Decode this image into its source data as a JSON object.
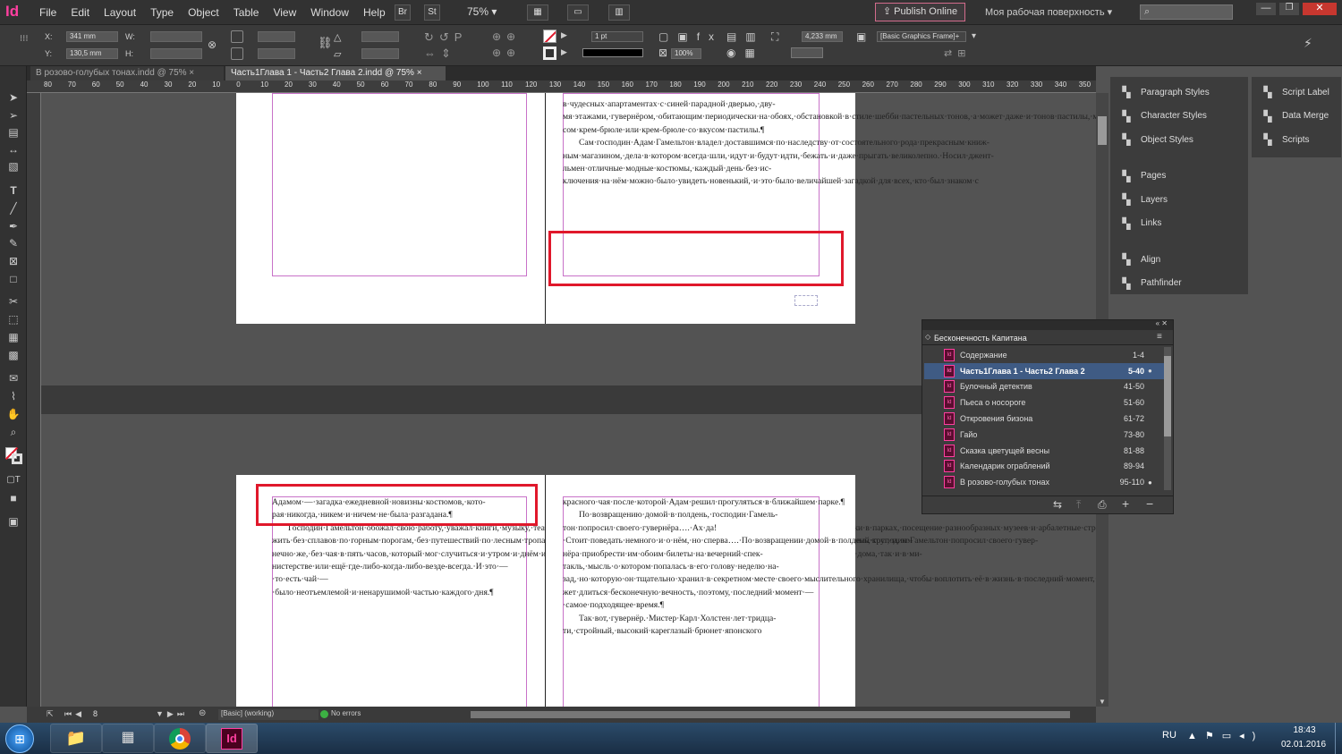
{
  "app": {
    "logo": "Id",
    "menu": [
      "File",
      "Edit",
      "Layout",
      "Type",
      "Object",
      "Table",
      "View",
      "Window",
      "Help"
    ],
    "br_badge": "Br",
    "st_badge": "St",
    "zoom": "75%",
    "publish_online": "Publish Online",
    "workspace": "Моя рабочая поверхность"
  },
  "control": {
    "x_label": "X:",
    "x_value": "341 mm",
    "y_label": "Y:",
    "y_value": "130,5 mm",
    "w_label": "W:",
    "h_label": "H:",
    "stroke_weight": "1 pt",
    "zoom_field": "100%",
    "size_field": "4,233 mm",
    "frame_style": "[Basic Graphics Frame]+"
  },
  "tabs": [
    {
      "label": "В розово-голубых тонах.indd @ 75%",
      "close": "×"
    },
    {
      "label": "Часть1Глава 1 - Часть2 Глава 2.indd @ 75%",
      "close": "×"
    }
  ],
  "ruler_ticks": [
    "80",
    "70",
    "60",
    "50",
    "40",
    "30",
    "20",
    "10",
    "0",
    "10",
    "20",
    "30",
    "40",
    "50",
    "60",
    "70",
    "80",
    "90",
    "100",
    "110",
    "120",
    "130",
    "140",
    "150",
    "160",
    "170",
    "180",
    "190",
    "200",
    "210",
    "220",
    "230",
    "240",
    "250",
    "260",
    "270",
    "280",
    "290",
    "300",
    "310",
    "320",
    "330",
    "340",
    "350"
  ],
  "doc": {
    "top_right_text": "в·чудесных·апартаментах·с·синей·парадной·дверью,·дву-мя·этажами,·гувернёром,·обитающим·периодически·на·обоях,·обстановкой·в·стиле·шебби·пастельных·тонов,·а·может·даже·и·тонов·пастилы,·может·даже·пастилы·со·вку-сом·крем-брюле·или·крем-брюле·со·вкусом·пастилы.¶",
    "top_right_text2": "Сам·господин·Адам·Гамельтон·владел·доставшимся·по·наследству·от·состоятельного·рода·прекрасным·книж-ным·магазином,·дела·в·котором·всегда·шли,·идут·и·будут·идти,·бежать·и·даже·прыгать·великолепно.·Носил·джент-льмен·отличные·модные·костюмы,·каждый·день·без·ис-ключения·на·нём·можно·было·увидеть·новенький,·и·это·было·величайшей·загадкой·для·всех,·кто·был·знаком·с",
    "bottom_left_text": "Адамом·—·загадка·ежедневной·новизны·костюмов,·кото-рая·никогда,·никем·и·ничем·не·была·разгадана.¶",
    "bottom_left_text2": "Господин·Гамельтон·обожал·свою·работу,·уважал·книги,·музыку,·театр,·а·также·крокет,·верховую·езду,·бадминтон,·фехтование,·поездки·загород,·пикники·в·парках,·посещение·разнообразных·музеев·и·арбалетные·стрельбищи.·Не·мог·он·долго·про-жить·без·сплавов·по·горным·порогам,·без·путешествий·по·лесным·тропам,·без·восхождений·на·вершины·скал.·Он·да,·не·мог·он·и·без·экспедиций·за·полярный·круг,·и,·ко-нечно·же,·без·чая·в·пять·часов,·который·мог·случиться·и·утром·и·днём·и·вечером·и·даже·ночью,·как·раньше,·так·и·позже,·как·скорее,·так·и·медленнее,·как·дома,·так·и·в·ми-нистерстве·или·ещё·где-либо-когда-либо-везде-всегда.·И·это·—·то·есть·чай·—·было·неотъемлемой·и·ненарушимой·частью·каждого·дня.¶",
    "bottom_right_text": "красного·чая·после·которой·Адам·решил·прогуляться·в·ближайшем·парке.¶",
    "bottom_right_text2": "По·возвращению·домой·в·полдень,·господин·Гамель-тон·попросил·своего·гувернёра….·Ах·да!·Стоит·поведать·немного·и·о·нём,·но·сперва….·По·возвращении·домой·в·полдень,·господин·Гамельтон·попросил·своего·гувер-нёра·приобрести·им·обоим·билеты·на·вечерний·спек-такль,·мысль·о·котором·попалась·в·его·голову·неделю·на-зад,·но·которую·он·тщательно·хранил·в·секретном·месте·своего·мыслительного·хранилища,·чтобы·воплотить·её·в·жизнь·в·последний·момент,·ведь·последние·моменты·всегда·интереснее·давно·запланированных,·а·давно·мо-жет·длиться·бесконечную·вечность,·поэтому,·последний·момент·—·самое·подходящее·время.¶",
    "bottom_right_text3": "Так·вот,·гувернёр.·Мистер·Карл·Холстен·лет·тридца-ти,·стройный,·высокий·кареглазый·брюнет·японского"
  },
  "status": {
    "page": "8",
    "profile": "[Basic] (working)",
    "errors": "No errors"
  },
  "dock": {
    "col1": [
      {
        "label": "Paragraph Styles",
        "icon": "paragraph-styles-icon"
      },
      {
        "label": "Character Styles",
        "icon": "character-styles-icon"
      },
      {
        "label": "Object Styles",
        "icon": "object-styles-icon"
      },
      {
        "label": "Pages",
        "icon": "pages-icon"
      },
      {
        "label": "Layers",
        "icon": "layers-icon"
      },
      {
        "label": "Links",
        "icon": "links-icon"
      },
      {
        "label": "Align",
        "icon": "align-icon"
      },
      {
        "label": "Pathfinder",
        "icon": "pathfinder-icon"
      }
    ],
    "col2": [
      {
        "label": "Script Label",
        "icon": "script-label-icon"
      },
      {
        "label": "Data Merge",
        "icon": "data-merge-icon"
      },
      {
        "label": "Scripts",
        "icon": "scripts-icon"
      }
    ]
  },
  "book": {
    "title": "Бесконечность Капитана",
    "items": [
      {
        "name": "Содержание",
        "pages": "1-4",
        "selected": false
      },
      {
        "name": "Часть1Глава 1 - Часть2 Глава 2",
        "pages": "5-40",
        "selected": true
      },
      {
        "name": "Булочный детектив",
        "pages": "41-50",
        "selected": false
      },
      {
        "name": "Пьеса о носороге",
        "pages": "51-60",
        "selected": false
      },
      {
        "name": "Откровения бизона",
        "pages": "61-72",
        "selected": false
      },
      {
        "name": "Гайо",
        "pages": "73-80",
        "selected": false
      },
      {
        "name": "Сказка цветущей весны",
        "pages": "81-88",
        "selected": false
      },
      {
        "name": "Календарик ограблений",
        "pages": "89-94",
        "selected": false
      },
      {
        "name": "В розово-голубых тонах",
        "pages": "95-110",
        "selected": false
      }
    ]
  },
  "tray": {
    "lang": "RU",
    "time": "18:43",
    "date": "02.01.2016"
  },
  "colors": {
    "highlight": "#e0182b",
    "indesign_pink": "#ff3fa0",
    "selection_blue": "#3f5b84"
  }
}
